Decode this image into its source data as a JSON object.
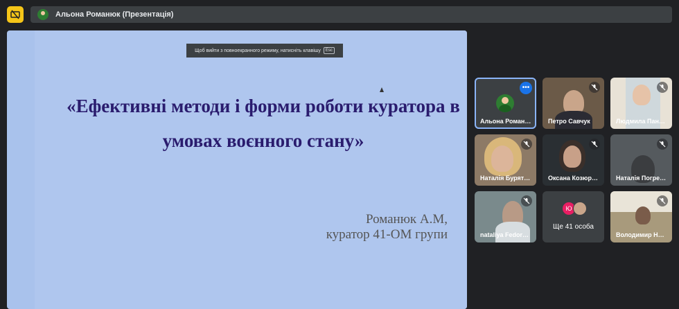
{
  "window": {
    "title": "Альона Романюк (Презентація)"
  },
  "presentation": {
    "esc_hint_text": "Щоб вийти з повноекранного режиму, натисніть клавішу",
    "esc_key": "Esc",
    "title_line1": "«Ефективні методи і форми роботи куратора в",
    "title_line2": "умовах воєнного стану»",
    "author_name": "Романюк А.М,",
    "author_role": "куратор 41-ОМ групи"
  },
  "participants": [
    {
      "name": "Альона Роман…",
      "muted": false,
      "more_button": "•••"
    },
    {
      "name": "Петро Савчук",
      "muted": true
    },
    {
      "name": "Людмила Пан…",
      "muted": true
    },
    {
      "name": "Наталія Бурят…",
      "muted": true
    },
    {
      "name": "Оксана Козюр…",
      "muted": true
    },
    {
      "name": "Наталія Погре…",
      "muted": true
    },
    {
      "name": "nataliya Fedor…",
      "muted": true
    },
    {
      "more_label": "Ще 41 особа",
      "avatar_letter": "Ю"
    },
    {
      "name": "Володимир Н…",
      "muted": true
    }
  ],
  "colors": {
    "accent_present": "#f5c518",
    "slide_bg": "#afc6ee",
    "title_color": "#2a1c6e",
    "active_outline": "#8ab4f8"
  }
}
